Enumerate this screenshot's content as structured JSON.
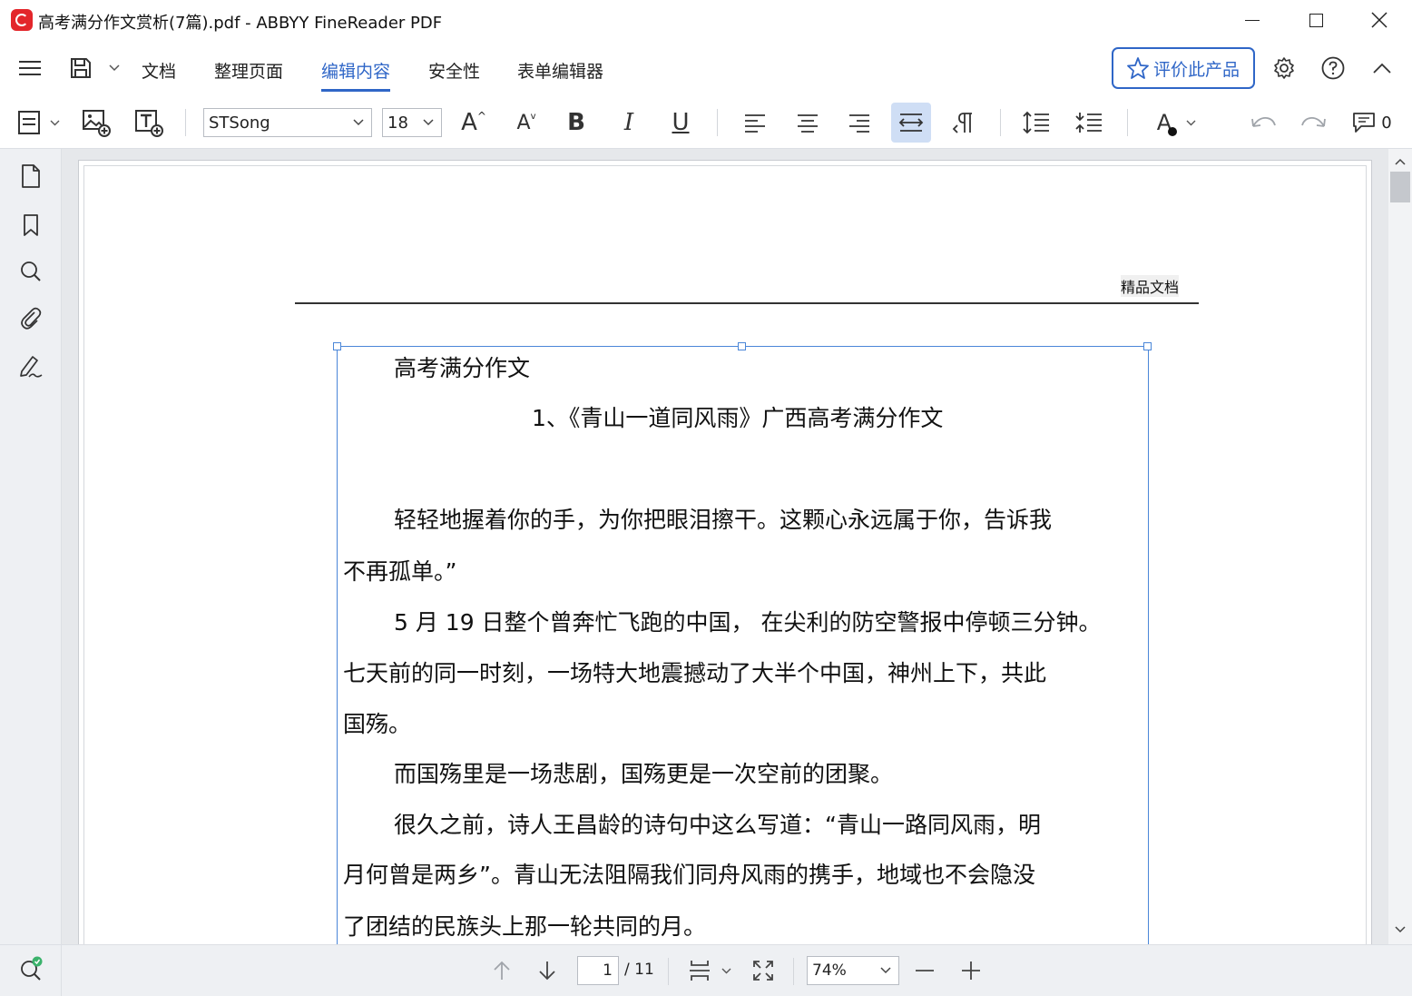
{
  "window": {
    "title": "高考满分作文赏析(7篇).pdf - ABBYY FineReader PDF"
  },
  "menu": {
    "tabs": [
      {
        "label": "文档"
      },
      {
        "label": "整理页面"
      },
      {
        "label": "编辑内容",
        "active": true
      },
      {
        "label": "安全性"
      },
      {
        "label": "表单编辑器"
      }
    ],
    "rate_label": "评价此产品"
  },
  "toolbar": {
    "font": "STSong",
    "font_size": "18",
    "increase_font_glyph": "A",
    "decrease_font_glyph": "A",
    "bold_glyph": "B",
    "italic_glyph": "I",
    "underline_glyph": "U",
    "text_color_glyph": "A",
    "comments_count": "0"
  },
  "document": {
    "header": "精品文档",
    "lines": [
      "高考满分作文",
      "1、《青山一道同风雨》广西高考满分作文",
      "轻轻地握着你的手，为你把眼泪擦干。这颗心永远属于你，告诉我",
      "不再孤单。”",
      "5 月 19 日整个曾奔忙飞跑的中国，  在尖利的防空警报中停顿三分钟。",
      "七天前的同一时刻，一场特大地震撼动了大半个中国，神州上下，共此",
      "国殇。",
      "而国殇里是一场悲剧，国殇更是一次空前的团聚。",
      "很久之前，诗人王昌龄的诗句中这么写道：“青山一路同风雨，明",
      "月何曾是两乡”。青山无法阻隔我们同舟风雨的携手，地域也不会隐没",
      "了团结的民族头上那一轮共同的月。"
    ]
  },
  "navigation": {
    "current_page": "1",
    "total_pages": "/ 11",
    "zoom": "74%"
  },
  "colors": {
    "accent": "#2f66c7",
    "selection": "#4a86d8",
    "logo": "#e3262b"
  }
}
